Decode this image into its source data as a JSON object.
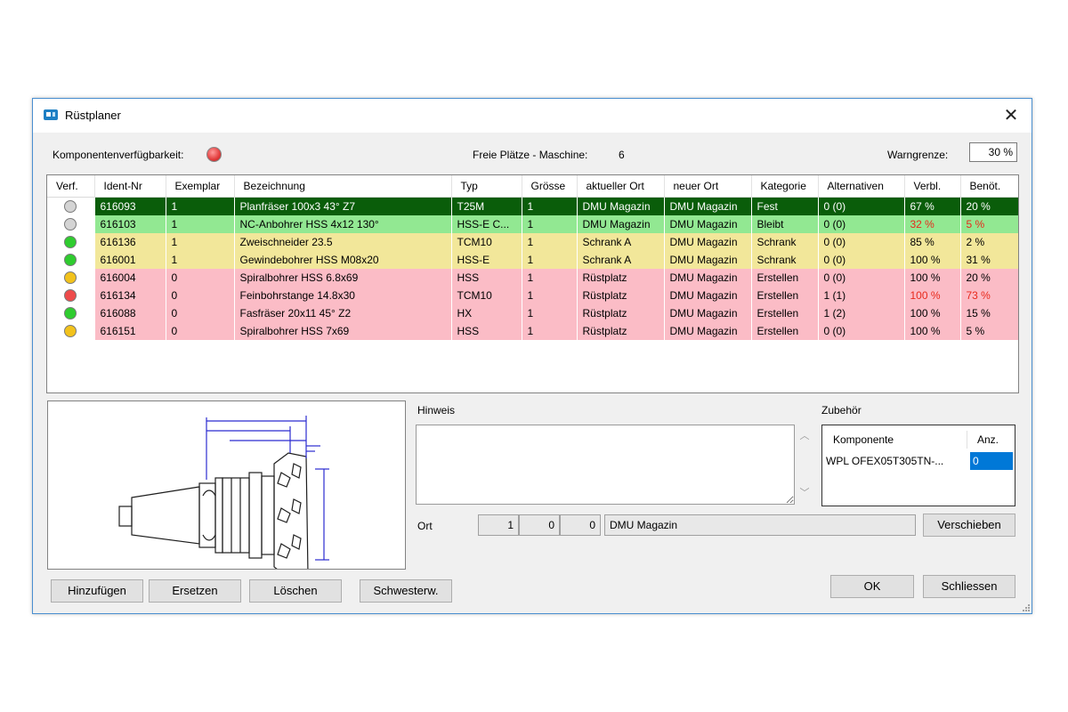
{
  "window": {
    "title": "Rüstplaner"
  },
  "header": {
    "availability_label": "Komponentenverfügbarkeit:",
    "free_places_label": "Freie Plätze - Maschine:",
    "free_places_value": "6",
    "warn_label": "Warngrenze:",
    "warn_value": "30 %"
  },
  "table": {
    "columns": [
      "Verf.",
      "Ident-Nr",
      "Exemplar",
      "Bezeichnung",
      "Typ",
      "Grösse",
      "aktueller Ort",
      "neuer Ort",
      "Kategorie",
      "Alternativen",
      "Verbl.",
      "Benöt."
    ],
    "rows": [
      {
        "status": "grey",
        "bg": "#0a5d0a",
        "fg": "#ffffff",
        "id": "616093",
        "exemplar": "1",
        "name": "Planfräser 100x3 43° Z7",
        "type": "T25M",
        "size": "1",
        "current": "DMU Magazin",
        "new": "DMU Magazin",
        "category": "Fest",
        "alt": "0 (0)",
        "remaining": "67 %",
        "needed": "20 %",
        "remaining_color": "#ffffff",
        "needed_color": "#ffffff"
      },
      {
        "status": "grey",
        "bg": "#92e892",
        "fg": "#000000",
        "id": "616103",
        "exemplar": "1",
        "name": "NC-Anbohrer HSS 4x12 130°",
        "type": "HSS-E C...",
        "size": "1",
        "current": "DMU Magazin",
        "new": "DMU Magazin",
        "category": "Bleibt",
        "alt": "0 (0)",
        "remaining": "32 %",
        "needed": "5 %",
        "remaining_color": "#e8291c",
        "needed_color": "#e8291c"
      },
      {
        "status": "green",
        "bg": "#f2e79a",
        "fg": "#000000",
        "id": "616136",
        "exemplar": "1",
        "name": "Zweischneider 23.5",
        "type": "TCM10",
        "size": "1",
        "current": "Schrank A",
        "new": "DMU Magazin",
        "category": "Schrank",
        "alt": "0 (0)",
        "remaining": "85 %",
        "needed": "2 %",
        "remaining_color": "#000000",
        "needed_color": "#000000"
      },
      {
        "status": "green",
        "bg": "#f2e79a",
        "fg": "#000000",
        "id": "616001",
        "exemplar": "1",
        "name": "Gewindebohrer HSS M08x20",
        "type": "HSS-E",
        "size": "1",
        "current": "Schrank A",
        "new": "DMU Magazin",
        "category": "Schrank",
        "alt": "0 (0)",
        "remaining": "100 %",
        "needed": "31 %",
        "remaining_color": "#000000",
        "needed_color": "#000000"
      },
      {
        "status": "yellow",
        "bg": "#fbbcc6",
        "fg": "#000000",
        "id": "616004",
        "exemplar": "0",
        "name": "Spiralbohrer HSS 6.8x69",
        "type": "HSS",
        "size": "1",
        "current": "Rüstplatz",
        "new": "DMU Magazin",
        "category": "Erstellen",
        "alt": "0 (0)",
        "remaining": "100 %",
        "needed": "20 %",
        "remaining_color": "#000000",
        "needed_color": "#000000"
      },
      {
        "status": "red",
        "bg": "#fbbcc6",
        "fg": "#000000",
        "id": "616134",
        "exemplar": "0",
        "name": "Feinbohrstange 14.8x30",
        "type": "TCM10",
        "size": "1",
        "current": "Rüstplatz",
        "new": "DMU Magazin",
        "category": "Erstellen",
        "alt": "1 (1)",
        "remaining": "100 %",
        "needed": "73 %",
        "remaining_color": "#e8291c",
        "needed_color": "#e8291c"
      },
      {
        "status": "green",
        "bg": "#fbbcc6",
        "fg": "#000000",
        "id": "616088",
        "exemplar": "0",
        "name": "Fasfräser 20x11 45° Z2",
        "type": "HX",
        "size": "1",
        "current": "Rüstplatz",
        "new": "DMU Magazin",
        "category": "Erstellen",
        "alt": "1 (2)",
        "remaining": "100 %",
        "needed": "15 %",
        "remaining_color": "#000000",
        "needed_color": "#000000"
      },
      {
        "status": "yellow",
        "bg": "#fbbcc6",
        "fg": "#000000",
        "id": "616151",
        "exemplar": "0",
        "name": "Spiralbohrer HSS 7x69",
        "type": "HSS",
        "size": "1",
        "current": "Rüstplatz",
        "new": "DMU Magazin",
        "category": "Erstellen",
        "alt": "0 (0)",
        "remaining": "100 %",
        "needed": "5 %",
        "remaining_color": "#000000",
        "needed_color": "#000000"
      }
    ]
  },
  "status_colors": {
    "grey": "#d4d4d4",
    "green": "#2fcc2f",
    "yellow": "#f2c21c",
    "red": "#ee4b4b"
  },
  "hint": {
    "label": "Hinweis",
    "scroll_up_icon": "chevron-up-icon",
    "scroll_down_icon": "chevron-down-icon"
  },
  "accessory": {
    "label": "Zubehör",
    "col_component": "Komponente",
    "col_qty": "Anz.",
    "rows": [
      {
        "component": "WPL OFEX05T305TN-...",
        "qty": "0"
      }
    ]
  },
  "location": {
    "label": "Ort",
    "f1": "1",
    "f2": "0",
    "f3": "0",
    "name": "DMU Magazin",
    "move_button": "Verschieben"
  },
  "buttons": {
    "add": "Hinzufügen",
    "replace": "Ersetzen",
    "delete": "Löschen",
    "sibling": "Schwesterw.",
    "ok": "OK",
    "close": "Schliessen"
  },
  "drawing": {
    "icon": "tool-holder-drawing"
  }
}
